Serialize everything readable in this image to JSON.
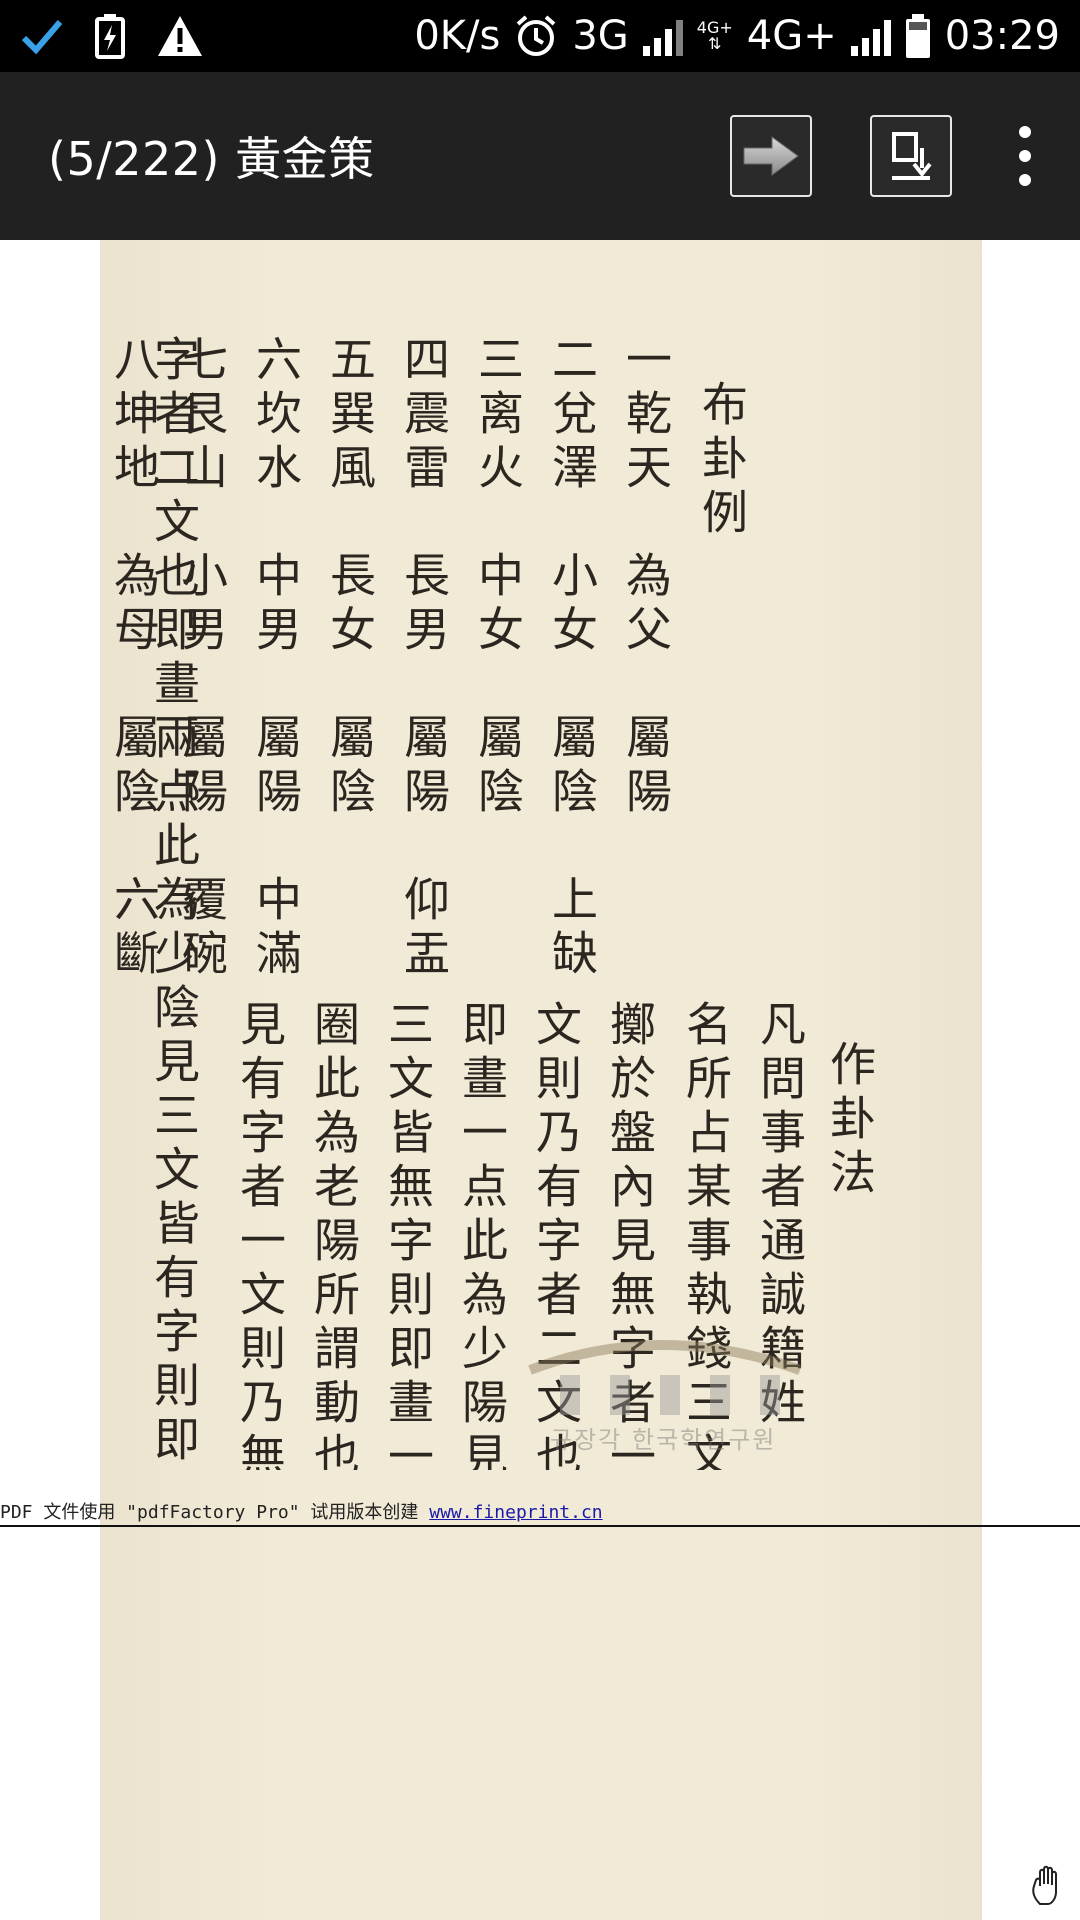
{
  "status_bar": {
    "speed": "0K/s",
    "net_3g": "3G",
    "net_4g_badge": "4G+",
    "net_4g": "4G+",
    "time": "03:29"
  },
  "app_bar": {
    "title": "(5/222) 黃金策"
  },
  "document": {
    "heading_1": "布卦例",
    "lines_1": [
      "一乾天　為父　屬陽",
      "二兌澤　小女　屬陰　上缺",
      "三离火　中女　屬陰",
      "四震雷　長男　屬陽　仰盂",
      "五巽風　長女　屬陰",
      "六坎水　中男　屬陽　中滿",
      "七艮山　小男　屬陽　覆碗",
      "八坤地　為母　屬陰　六斷"
    ],
    "heading_2": "作卦法",
    "lines_2": [
      "凡問事者通誠籍姓",
      "名所占某事執錢三文",
      "擲於盤內見無字者一",
      "文則乃有字者二文也",
      "即畫一点此為少陽見",
      "三文皆無字則即畫一",
      "圈此為老陽所謂動也",
      "見有字者一文則乃無",
      "字者二文也即畫兩点此為少陰見三文皆有字則即"
    ],
    "watermark": "규장각 한국학연구원"
  },
  "footer": {
    "text": "PDF 文件使用 \"pdfFactory Pro\" 试用版本创建 ",
    "link": "www.fineprint.cn"
  }
}
